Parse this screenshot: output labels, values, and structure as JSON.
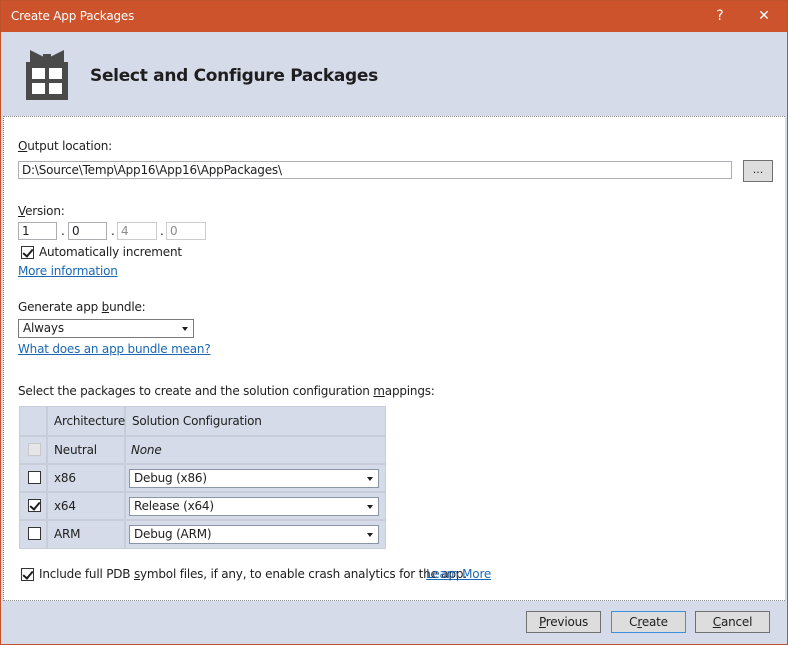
{
  "window": {
    "title": "Create App Packages",
    "help_label": "?",
    "close_label": "✕"
  },
  "header": {
    "title": "Select and Configure Packages",
    "icon": "gift-package-icon"
  },
  "output_location": {
    "label_accel": "O",
    "label_rest": "utput location:",
    "value": "D:\\Source\\Temp\\App16\\App16\\AppPackages\\",
    "browse_label": "..."
  },
  "version": {
    "label_accel": "V",
    "label_rest": "ersion:",
    "parts": [
      "1",
      "0",
      "4",
      "0"
    ],
    "separator": ".",
    "auto_increment_label": "Automatically increment",
    "auto_increment_checked": true,
    "more_info_link": "More information"
  },
  "bundle": {
    "label_pre": "Generate app ",
    "label_accel": "b",
    "label_rest": "undle:",
    "selected": "Always",
    "help_link": "What does an app bundle mean?"
  },
  "packages": {
    "label_pre": "Select the packages to create and the solution configuration ",
    "label_accel": "m",
    "label_rest": "appings:",
    "columns": [
      "Architecture",
      "Solution Configuration"
    ],
    "rows": [
      {
        "architecture": "Neutral",
        "configuration": "None",
        "checked": false,
        "enabled": false,
        "has_dropdown": false
      },
      {
        "architecture": "x86",
        "configuration": "Debug (x86)",
        "checked": false,
        "enabled": true,
        "has_dropdown": true
      },
      {
        "architecture": "x64",
        "configuration": "Release (x64)",
        "checked": true,
        "enabled": true,
        "has_dropdown": true
      },
      {
        "architecture": "ARM",
        "configuration": "Debug (ARM)",
        "checked": false,
        "enabled": true,
        "has_dropdown": true
      }
    ]
  },
  "pdb": {
    "label_pre": "Include full PDB ",
    "label_accel": "s",
    "label_rest": "ymbol files, if any, to enable crash analytics for the app.",
    "checked": true,
    "learn_more_link": "Learn More"
  },
  "footer": {
    "previous_accel": "P",
    "previous_rest": "revious",
    "create_pre": "C",
    "create_accel": "r",
    "create_rest": "eate",
    "cancel_accel": "C",
    "cancel_rest": "ancel"
  },
  "colors": {
    "titlebar": "#cc532c",
    "header_bg": "#d6dbe9",
    "link": "#1a67b5",
    "default_button_border": "#3c8fdc"
  }
}
